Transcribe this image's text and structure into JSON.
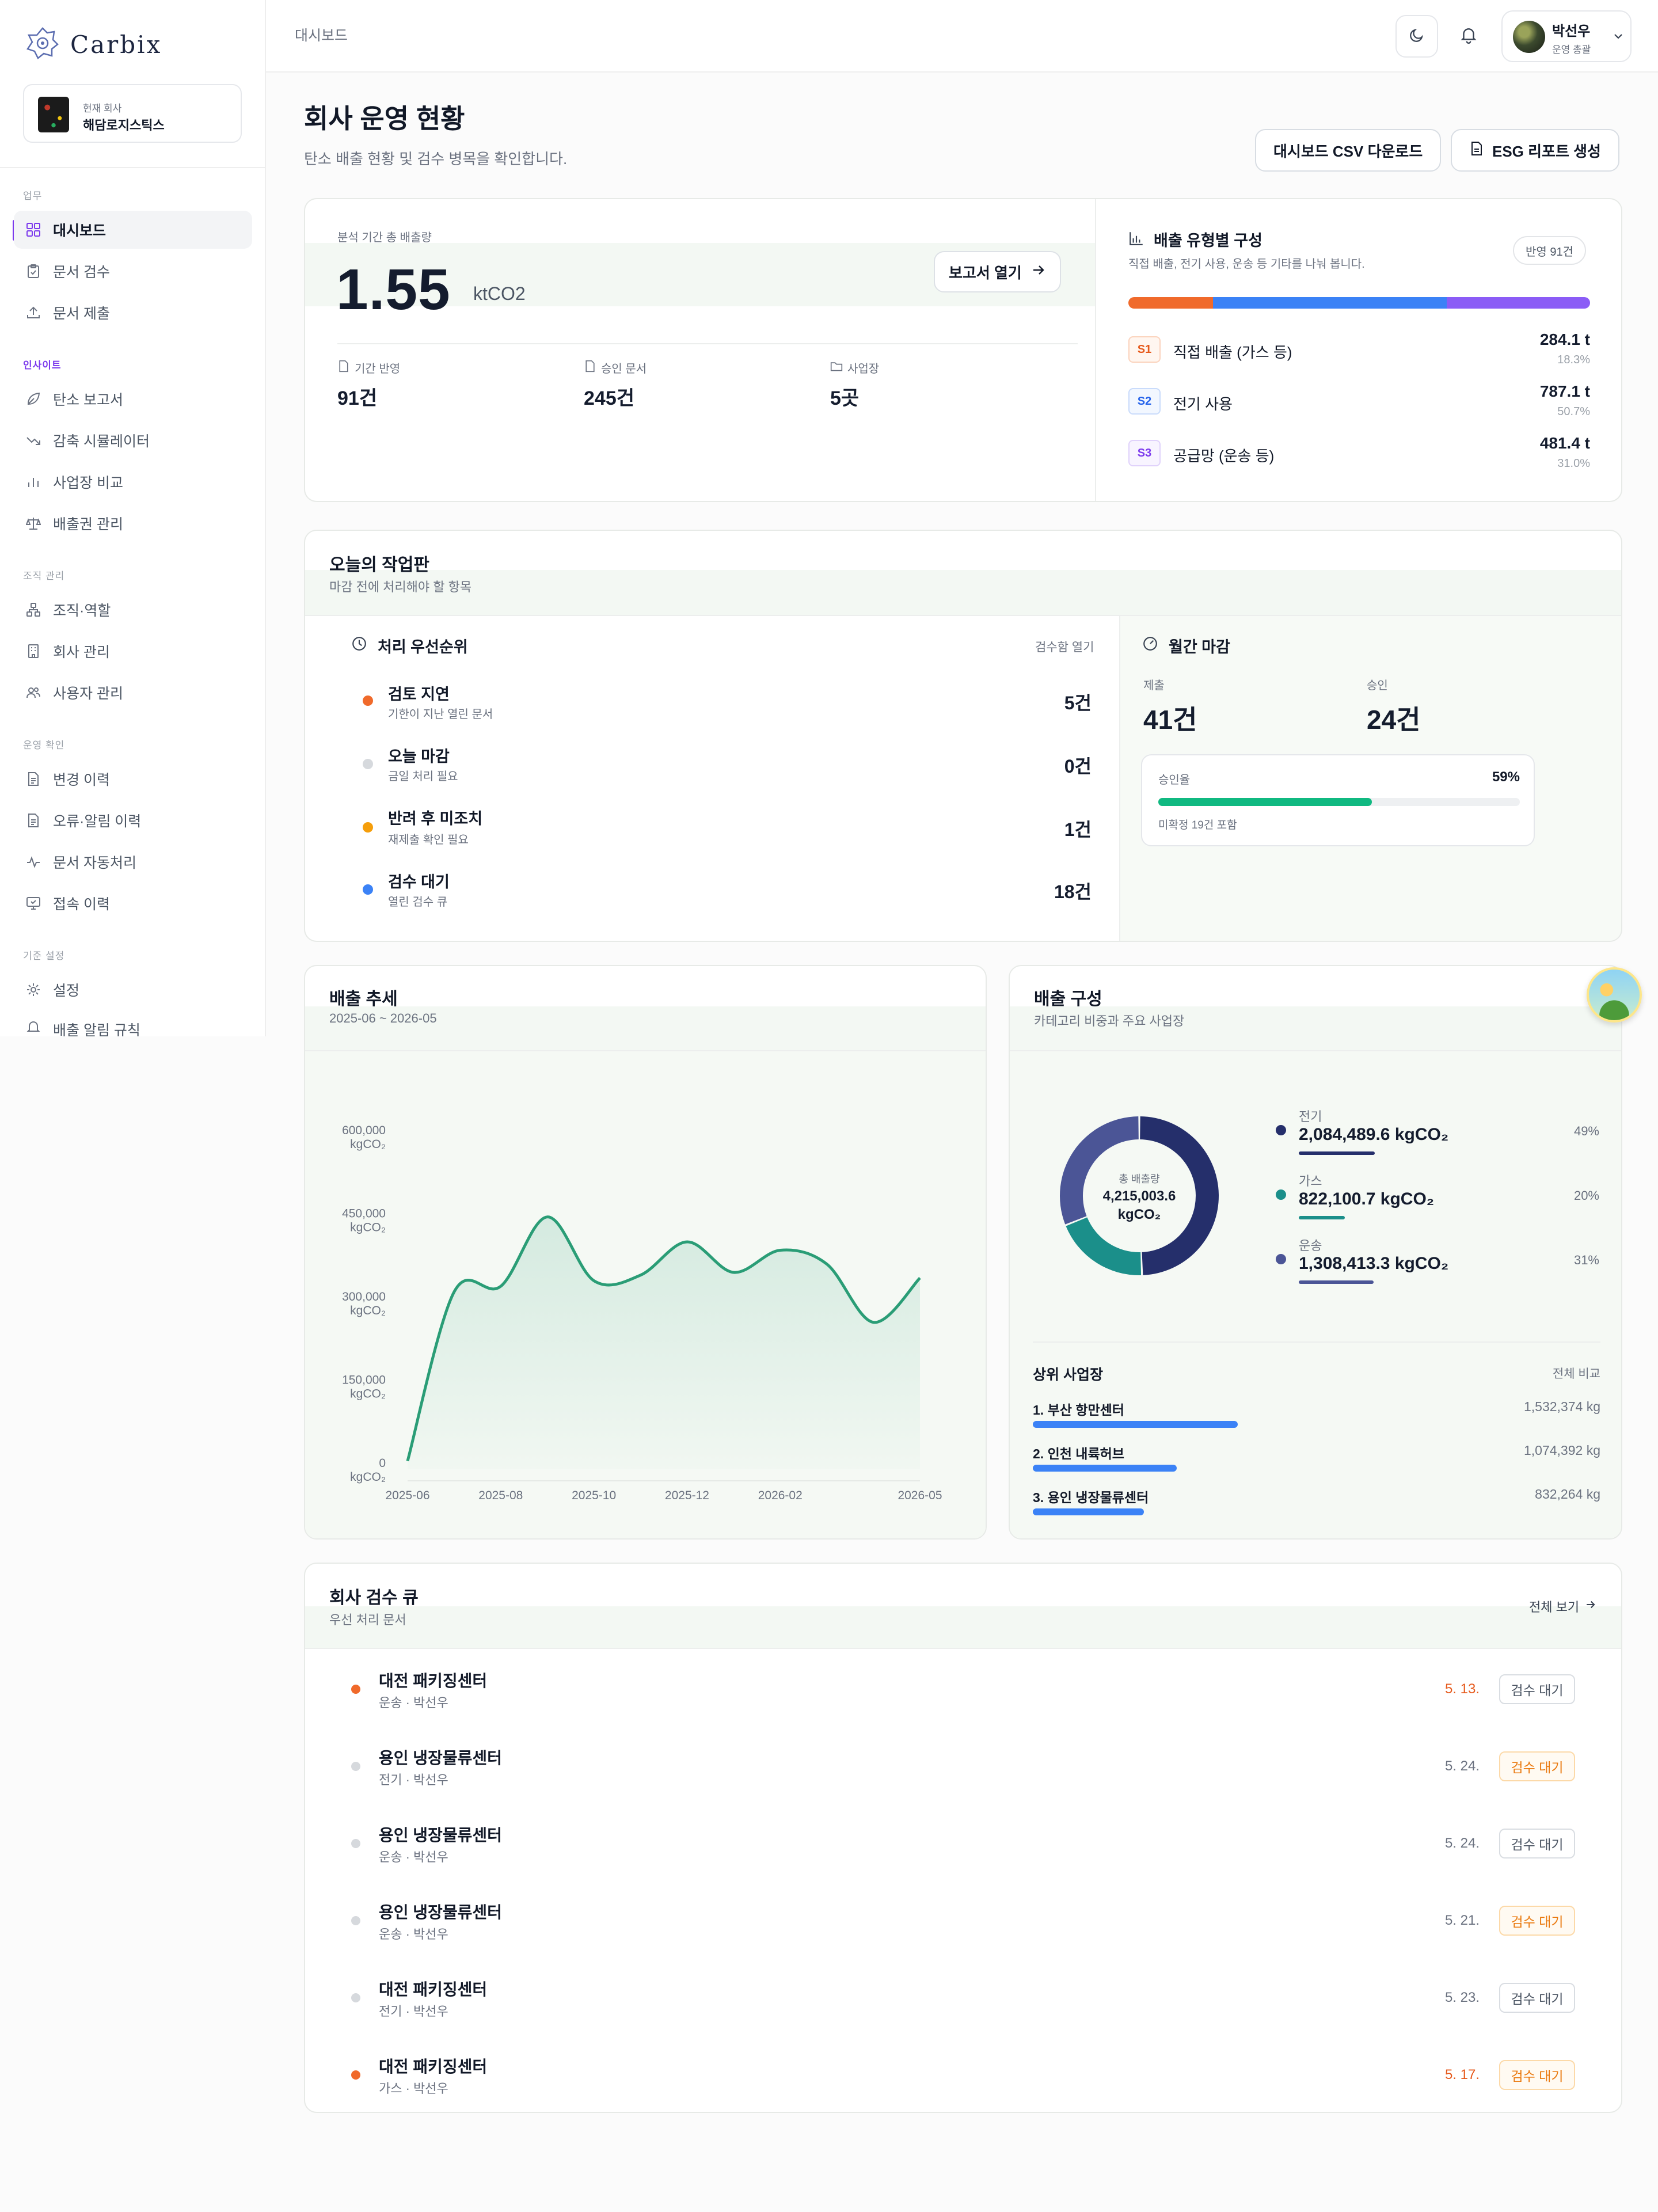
{
  "app": {
    "logo": "Carbix",
    "company_label": "현재 회사",
    "company_name": "해담로지스틱스"
  },
  "sidebar": {
    "sections": [
      {
        "title": "업무",
        "items": [
          "대시보드",
          "문서 검수",
          "문서 제출"
        ]
      },
      {
        "title": "인사이트",
        "items": [
          "탄소 보고서",
          "감축 시뮬레이터",
          "사업장 비교",
          "배출권 관리"
        ]
      },
      {
        "title": "조직 관리",
        "items": [
          "조직·역할",
          "회사 관리",
          "사용자 관리"
        ]
      },
      {
        "title": "운영 확인",
        "items": [
          "변경 이력",
          "오류·알림 이력",
          "문서 자동처리",
          "접속 이력"
        ]
      },
      {
        "title": "기준 설정",
        "items": [
          "설정",
          "배출 알림 규칙"
        ]
      }
    ],
    "active_item": "대시보드"
  },
  "topbar": {
    "breadcrumb": "대시보드",
    "user_name": "박선우",
    "user_role": "운영 총괄"
  },
  "page": {
    "title": "회사 운영 현황",
    "subtitle": "탄소 배출 현황 및 검수 병목을 확인합니다.",
    "csv_button": "대시보드 CSV 다운로드",
    "esg_button": "ESG 리포트 생성"
  },
  "summary": {
    "label": "분석 기간 총 배출량",
    "total": "1.55",
    "unit": "ktCO2",
    "report_button": "보고서 열기",
    "stats": [
      {
        "label": "기간 반영",
        "value": "91건"
      },
      {
        "label": "승인 문서",
        "value": "245건"
      },
      {
        "label": "사업장",
        "value": "5곳"
      }
    ]
  },
  "scope_breakdown": {
    "title": "배출 유형별 구성",
    "subtitle": "직접 배출, 전기 사용, 운송 등 기타를 나눠 봅니다.",
    "badge": "반영 91건",
    "colors": [
      "#f06a2b",
      "#3b82f6",
      "#8b5cf6"
    ],
    "items": [
      {
        "tag": "S1",
        "name": "직접 배출 (가스 등)",
        "value": "284.1 t",
        "pct": "18.3%",
        "share": 18.3
      },
      {
        "tag": "S2",
        "name": "전기 사용",
        "value": "787.1 t",
        "pct": "50.7%",
        "share": 50.7
      },
      {
        "tag": "S3",
        "name": "공급망 (운송 등)",
        "value": "481.4 t",
        "pct": "31.0%",
        "share": 31.0
      }
    ]
  },
  "worklist": {
    "title": "오늘의 작업판",
    "subtitle": "마감 전에 처리해야 할 항목",
    "priority_title": "처리 우선순위",
    "priority_link": "검수함 열기",
    "priorities": [
      {
        "name": "검토 지연",
        "desc": "기한이 지난 열린 문서",
        "count": "5건",
        "color": "#f06a2b"
      },
      {
        "name": "오늘 마감",
        "desc": "금일 처리 필요",
        "count": "0건",
        "color": "#d6d9dd"
      },
      {
        "name": "반려 후 미조치",
        "desc": "재제출 확인 필요",
        "count": "1건",
        "color": "#f59e0b"
      },
      {
        "name": "검수 대기",
        "desc": "열린 검수 큐",
        "count": "18건",
        "color": "#3b82f6"
      }
    ],
    "monthly_title": "월간 마감",
    "submitted_label": "제출",
    "submitted_value": "41건",
    "approved_label": "승인",
    "approved_value": "24건",
    "approval_rate_label": "승인율",
    "approval_rate": "59%",
    "approval_fraction": 0.59,
    "approval_note": "미확정 19건 포함"
  },
  "trend": {
    "title": "배출 추세",
    "subtitle": "2025-06 ~ 2026-05"
  },
  "chart_data": {
    "type": "area",
    "title": "배출 추세",
    "subtitle": "2025-06 ~ 2026-05",
    "x": [
      "2025-06",
      "2025-07",
      "2025-08",
      "2025-09",
      "2025-10",
      "2025-11",
      "2025-12",
      "2026-01",
      "2026-02",
      "2026-03",
      "2026-04",
      "2026-05"
    ],
    "x_tick_labels": [
      "2025-06",
      "2025-08",
      "2025-10",
      "2025-12",
      "2026-02",
      "2026-05"
    ],
    "values": [
      15000,
      320000,
      330000,
      455000,
      340000,
      350000,
      410000,
      355000,
      395000,
      370000,
      265000,
      345000
    ],
    "y_ticks": [
      0,
      150000,
      300000,
      450000,
      600000
    ],
    "y_tick_labels": [
      "0",
      "150,000",
      "300,000",
      "450,000",
      "600,000"
    ],
    "y_unit": "kgCO₂",
    "ylim": [
      0,
      600000
    ],
    "color": "#2a9d76",
    "grid": false
  },
  "composition": {
    "title": "배출 구성",
    "subtitle": "카테고리 비중과 주요 사업장",
    "center_label": "총 배출량",
    "center_value": "4,215,003.6",
    "center_unit": "kgCO₂",
    "segments": [
      {
        "label": "전기",
        "value": "2,084,489.6 kgCO₂",
        "pct": "49%",
        "share": 49.45,
        "color": "#252f6b"
      },
      {
        "label": "가스",
        "value": "822,100.7 kgCO₂",
        "pct": "20%",
        "share": 19.5,
        "color": "#1b8f8a"
      },
      {
        "label": "운송",
        "value": "1,308,413.3 kgCO₂",
        "pct": "31%",
        "share": 31.04,
        "color": "#4b5596"
      }
    ],
    "top_sites_title": "상위 사업장",
    "top_sites_link": "전체 비교",
    "top_sites": [
      {
        "name": "1. 부산 항만센터",
        "value": "1,532,374 kg",
        "amount": 1532374
      },
      {
        "name": "2. 인천 내륙허브",
        "value": "1,074,392 kg",
        "amount": 1074392
      },
      {
        "name": "3. 용인 냉장물류센터",
        "value": "832,264 kg",
        "amount": 832264
      }
    ]
  },
  "queue": {
    "title": "회사 검수 큐",
    "subtitle": "우선 처리 문서",
    "view_all": "전체 보기",
    "rows": [
      {
        "name": "대전 패키징센터",
        "meta": "운송 · 박선우",
        "date": "5. 13.",
        "status": "검수 대기",
        "overdue": true,
        "highlight": false
      },
      {
        "name": "용인 냉장물류센터",
        "meta": "전기 · 박선우",
        "date": "5. 24.",
        "status": "검수 대기",
        "overdue": false,
        "highlight": true
      },
      {
        "name": "용인 냉장물류센터",
        "meta": "운송 · 박선우",
        "date": "5. 24.",
        "status": "검수 대기",
        "overdue": false,
        "highlight": false
      },
      {
        "name": "용인 냉장물류센터",
        "meta": "운송 · 박선우",
        "date": "5. 21.",
        "status": "검수 대기",
        "overdue": false,
        "highlight": true
      },
      {
        "name": "대전 패키징센터",
        "meta": "전기 · 박선우",
        "date": "5. 23.",
        "status": "검수 대기",
        "overdue": false,
        "highlight": false
      },
      {
        "name": "대전 패키징센터",
        "meta": "가스 · 박선우",
        "date": "5. 17.",
        "status": "검수 대기",
        "overdue": true,
        "highlight": true
      }
    ]
  }
}
